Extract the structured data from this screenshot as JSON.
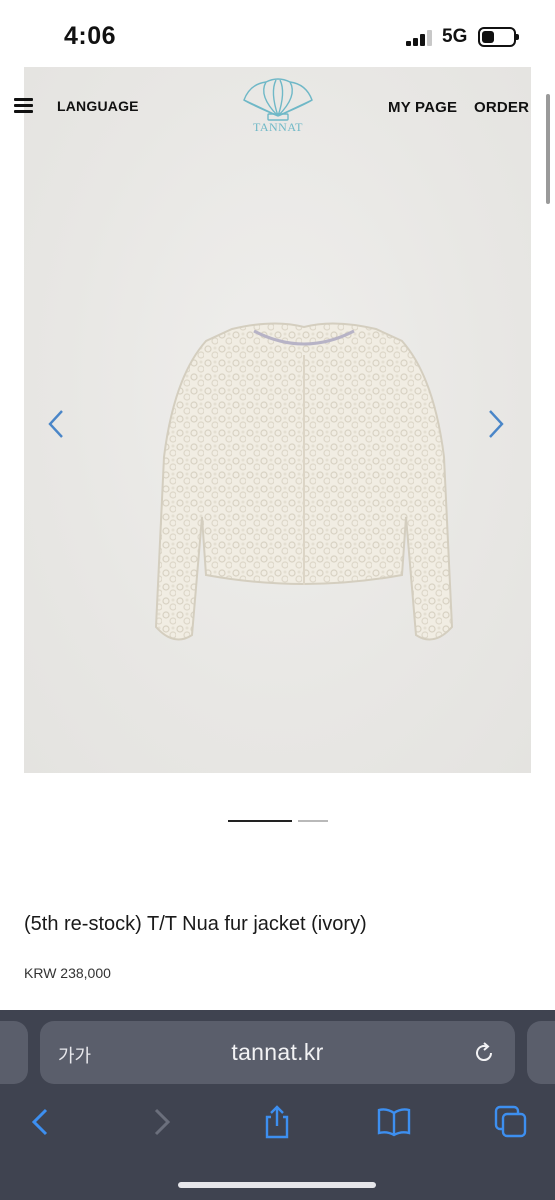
{
  "status_bar": {
    "time": "4:06",
    "network": "5G"
  },
  "header": {
    "language_label": "LANGUAGE",
    "logo_text": "TANNAT",
    "my_page_label": "MY PAGE",
    "order_label": "ORDER"
  },
  "gallery": {
    "image_subject": "ivory fur jacket",
    "page_count": 2,
    "current_page": 1
  },
  "product": {
    "title": "(5th re-stock) T/T Nua fur jacket (ivory)",
    "price": "KRW 238,000"
  },
  "browser": {
    "reader_label": "가가",
    "url": "tannat.kr"
  },
  "colors": {
    "accent_logo": "#6fb8c7",
    "arrow": "#4a86c8",
    "browser_bg": "#3f4350",
    "toolbar_icon": "#3d8ff0"
  }
}
